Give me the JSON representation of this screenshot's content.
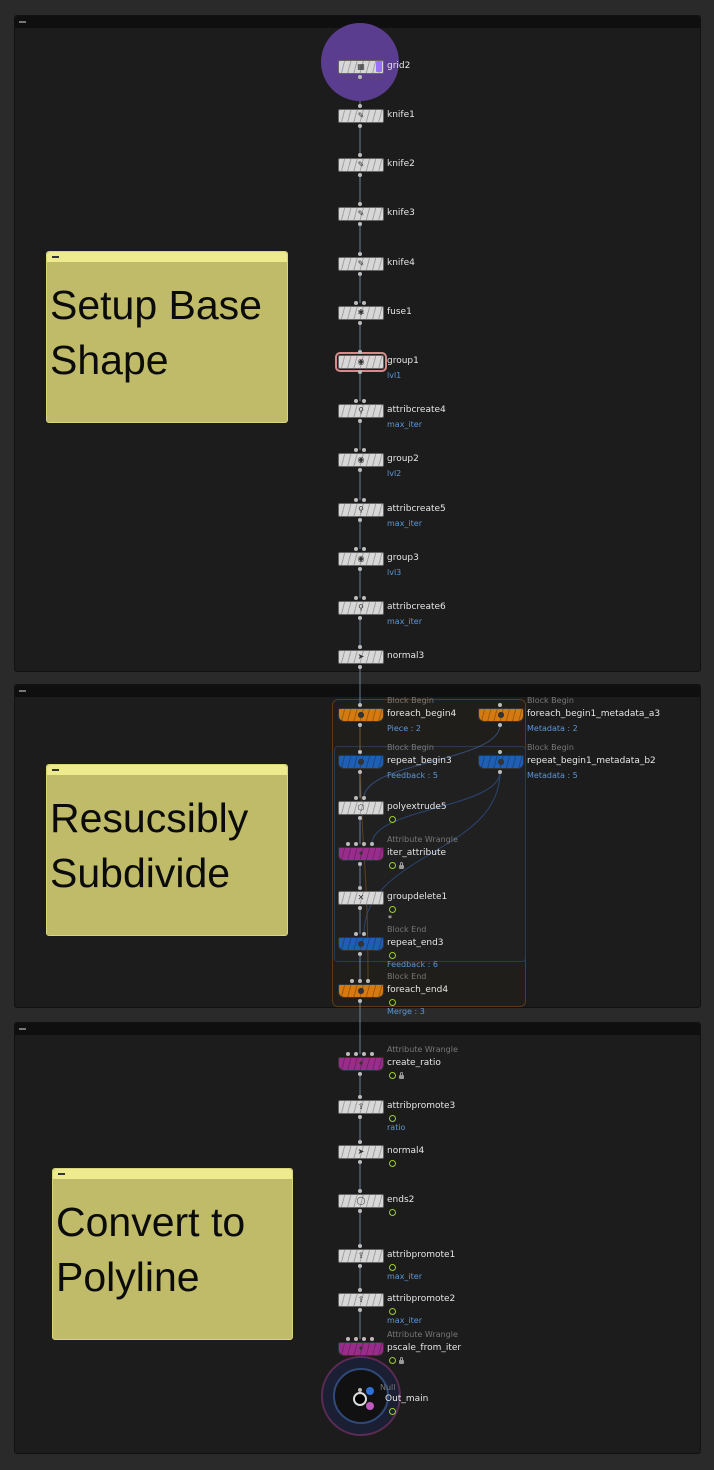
{
  "colors": {
    "panel": "#1c1c1c",
    "sticky": "#bfbb69",
    "node_default": "#d7d7d7",
    "node_orange": "#d47a10",
    "node_blue": "#1e5fb4",
    "node_magenta": "#9a2d8c",
    "param_text": "#5d97d6",
    "wire": "#7e98b8"
  },
  "stickies": [
    {
      "id": "s1",
      "text": "Setup Base\nShape"
    },
    {
      "id": "s2",
      "text": "Resucsibly\nSubdivide"
    },
    {
      "id": "s3",
      "text": "Convert to\nPolyline"
    }
  ],
  "nodes": [
    {
      "id": "grid2",
      "name": "grid2",
      "icon": "grid-icon"
    },
    {
      "id": "knife1",
      "name": "knife1",
      "icon": "knife-icon"
    },
    {
      "id": "knife2",
      "name": "knife2",
      "icon": "knife-icon"
    },
    {
      "id": "knife3",
      "name": "knife3",
      "icon": "knife-icon"
    },
    {
      "id": "knife4",
      "name": "knife4",
      "icon": "knife-icon"
    },
    {
      "id": "fuse1",
      "name": "fuse1",
      "icon": "fuse-icon"
    },
    {
      "id": "group1",
      "name": "group1",
      "icon": "group-icon",
      "param": "lvl1"
    },
    {
      "id": "attribcreate4",
      "name": "attribcreate4",
      "icon": "attribcreate-icon",
      "param": "max_iter"
    },
    {
      "id": "group2",
      "name": "group2",
      "icon": "group-icon",
      "param": "lvl2"
    },
    {
      "id": "attribcreate5",
      "name": "attribcreate5",
      "icon": "attribcreate-icon",
      "param": "max_iter"
    },
    {
      "id": "group3",
      "name": "group3",
      "icon": "group-icon",
      "param": "lvl3"
    },
    {
      "id": "attribcreate6",
      "name": "attribcreate6",
      "icon": "attribcreate-icon",
      "param": "max_iter"
    },
    {
      "id": "normal3",
      "name": "normal3",
      "icon": "normal-icon"
    },
    {
      "id": "foreach_begin4",
      "name": "foreach_begin4",
      "type": "Block Begin",
      "icon": "block-begin-icon",
      "param": "Piece : 2"
    },
    {
      "id": "foreach_begin1_metadata_a3",
      "name": "foreach_begin1_metadata_a3",
      "type": "Block Begin",
      "icon": "block-begin-icon",
      "param": "Metadata : 2"
    },
    {
      "id": "repeat_begin3",
      "name": "repeat_begin3",
      "type": "Block Begin",
      "icon": "block-begin-icon",
      "param": "Feedback : 5"
    },
    {
      "id": "repeat_begin1_metadata_b2",
      "name": "repeat_begin1_metadata_b2",
      "type": "Block Begin",
      "icon": "block-begin-icon",
      "param": "Metadata : 5"
    },
    {
      "id": "polyextrude5",
      "name": "polyextrude5",
      "icon": "polyextrude-icon"
    },
    {
      "id": "iter_attribute",
      "name": "iter_attribute",
      "type": "Attribute Wrangle",
      "icon": "wrangle-icon"
    },
    {
      "id": "groupdelete1",
      "name": "groupdelete1",
      "icon": "groupdelete-icon",
      "param": "*"
    },
    {
      "id": "repeat_end3",
      "name": "repeat_end3",
      "type": "Block End",
      "icon": "block-end-icon",
      "param": "Feedback : 6"
    },
    {
      "id": "foreach_end4",
      "name": "foreach_end4",
      "type": "Block End",
      "icon": "block-end-icon",
      "param": "Merge : 3"
    },
    {
      "id": "create_ratio",
      "name": "create_ratio",
      "type": "Attribute Wrangle",
      "icon": "wrangle-icon"
    },
    {
      "id": "attribpromote3",
      "name": "attribpromote3",
      "icon": "attribpromote-icon",
      "param": "ratio"
    },
    {
      "id": "normal4",
      "name": "normal4",
      "icon": "normal-icon"
    },
    {
      "id": "ends2",
      "name": "ends2",
      "icon": "ends-icon"
    },
    {
      "id": "attribpromote1",
      "name": "attribpromote1",
      "icon": "attribpromote-icon",
      "param": "max_iter"
    },
    {
      "id": "attribpromote2",
      "name": "attribpromote2",
      "icon": "attribpromote-icon",
      "param": "max_iter"
    },
    {
      "id": "pscale_from_iter",
      "name": "pscale_from_iter",
      "type": "Attribute Wrangle",
      "icon": "wrangle-icon"
    },
    {
      "id": "out_main",
      "name": "Out_main",
      "type": "Null",
      "icon": "null-icon"
    }
  ]
}
